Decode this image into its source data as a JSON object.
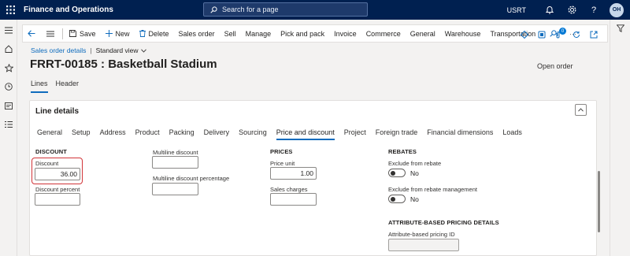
{
  "app": {
    "title": "Finance and Operations",
    "search_placeholder": "Search for a page",
    "company": "USRT",
    "avatar_initials": "OH"
  },
  "action_pane": {
    "save": "Save",
    "new": "New",
    "delete": "Delete",
    "menus": [
      "Sales order",
      "Sell",
      "Manage",
      "Pick and pack",
      "Invoice",
      "Commerce",
      "General",
      "Warehouse",
      "Transportation"
    ],
    "more": "···",
    "notification_count": "0"
  },
  "header": {
    "breadcrumb": "Sales order details",
    "view": "Standard view",
    "title": "FRRT-00185 : Basketball Stadium",
    "status": "Open order"
  },
  "page_tabs": [
    "Lines",
    "Header"
  ],
  "line_details": {
    "title": "Line details",
    "tabs": [
      "General",
      "Setup",
      "Address",
      "Product",
      "Packing",
      "Delivery",
      "Sourcing",
      "Price and discount",
      "Project",
      "Foreign trade",
      "Financial dimensions",
      "Loads"
    ],
    "active_tab": "Price and discount"
  },
  "discount": {
    "group": "DISCOUNT",
    "discount_label": "Discount",
    "discount_value": "36.00",
    "discount_percent_label": "Discount percent",
    "discount_percent_value": ""
  },
  "multiline": {
    "multiline_discount_label": "Multiline discount",
    "multiline_discount_value": "",
    "multiline_percent_label": "Multiline discount percentage",
    "multiline_percent_value": ""
  },
  "prices": {
    "group": "PRICES",
    "price_unit_label": "Price unit",
    "price_unit_value": "1.00",
    "sales_charges_label": "Sales charges",
    "sales_charges_value": ""
  },
  "rebates": {
    "group": "REBATES",
    "exclude_rebate_label": "Exclude from rebate",
    "exclude_rebate_value": "No",
    "exclude_rebate_mgmt_label": "Exclude from rebate management",
    "exclude_rebate_mgmt_value": "No"
  },
  "attribute_pricing": {
    "group": "ATTRIBUTE-BASED PRICING DETAILS",
    "pricing_id_label": "Attribute-based pricing ID",
    "pricing_id_value": ""
  }
}
